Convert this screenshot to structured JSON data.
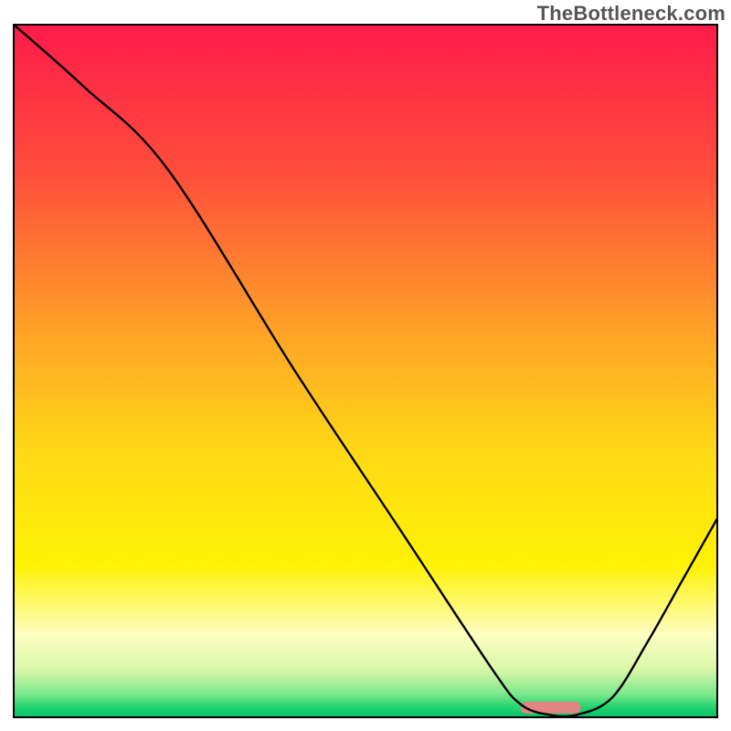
{
  "watermark": "TheBottleneck.com",
  "chart_data": {
    "type": "line",
    "title": "",
    "xlabel": "",
    "ylabel": "",
    "xlim": [
      0,
      100
    ],
    "ylim": [
      0,
      100
    ],
    "series": [
      {
        "name": "curve",
        "x": [
          0,
          10,
          22,
          40,
          55,
          68,
          72,
          76,
          80,
          85,
          90,
          95,
          100
        ],
        "y": [
          100,
          91,
          79,
          50,
          27,
          7,
          2,
          0.5,
          0.5,
          3,
          11,
          20,
          29
        ]
      }
    ],
    "marker": {
      "x_start": 72,
      "x_end": 80.5,
      "y": 1.6
    },
    "gradient_stops": [
      {
        "offset": 0.0,
        "color": "#ff1b4b"
      },
      {
        "offset": 0.22,
        "color": "#ff4f3b"
      },
      {
        "offset": 0.45,
        "color": "#ffa526"
      },
      {
        "offset": 0.62,
        "color": "#ffd915"
      },
      {
        "offset": 0.78,
        "color": "#fff205"
      },
      {
        "offset": 0.88,
        "color": "#fdfec3"
      },
      {
        "offset": 0.93,
        "color": "#d9f7a8"
      },
      {
        "offset": 0.965,
        "color": "#7de88c"
      },
      {
        "offset": 0.985,
        "color": "#1fd36d"
      },
      {
        "offset": 1.0,
        "color": "#05be66"
      }
    ],
    "band": {
      "y_top": 3.5,
      "y_bottom": 0
    }
  }
}
